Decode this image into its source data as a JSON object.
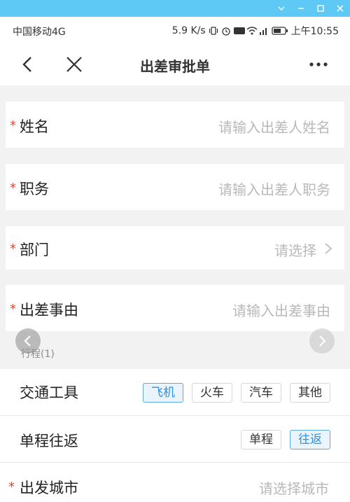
{
  "status_bar": {
    "carrier": "中国移动4G",
    "speed": "5.9 K/s",
    "time": "上午10:55"
  },
  "nav": {
    "title": "出差审批单"
  },
  "form": {
    "name": {
      "label": "姓名",
      "placeholder": "请输入出差人姓名",
      "required": "*"
    },
    "position": {
      "label": "职务",
      "placeholder": "请输入出差人职务",
      "required": "*"
    },
    "department": {
      "label": "部门",
      "placeholder": "请选择",
      "required": "*"
    },
    "reason": {
      "label": "出差事由",
      "placeholder": "请输入出差事由",
      "required": "*"
    }
  },
  "itinerary": {
    "section_title": "行程(1)",
    "transport": {
      "label": "交通工具",
      "options": [
        "飞机",
        "火车",
        "汽车",
        "其他"
      ],
      "selected": "飞机"
    },
    "trip_type": {
      "label": "单程往返",
      "options": [
        "单程",
        "往返"
      ],
      "selected": "往返"
    },
    "departure_city": {
      "label": "出发城市",
      "placeholder": "请选择城市",
      "required": "*"
    }
  },
  "colors": {
    "window_bar": "#5fc9f5",
    "accent": "#2f8fe0",
    "required": "#e04a3a"
  }
}
